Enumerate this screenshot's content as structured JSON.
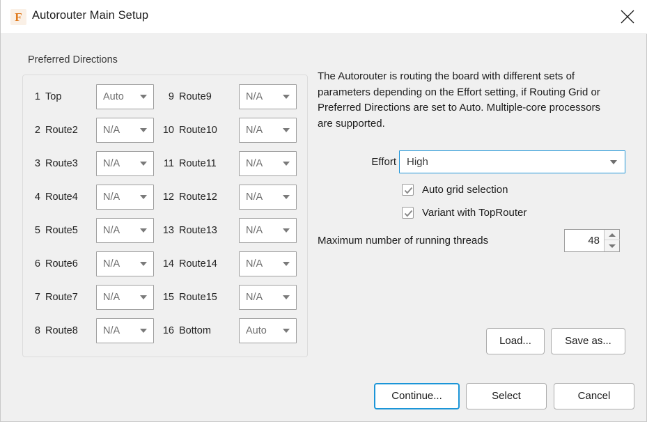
{
  "window": {
    "title": "Autorouter Main Setup",
    "app_icon": "app-icon",
    "app_icon_glyph": "F",
    "close_icon": "close-icon",
    "accent_color": "#1b95d8",
    "background_color": "#f0f0f0",
    "titlebar_color": "#ffffff"
  },
  "preferred_directions": {
    "group_title": "Preferred Directions",
    "rows": [
      {
        "num": "1",
        "label": "Top",
        "value": "Auto"
      },
      {
        "num": "2",
        "label": "Route2",
        "value": "N/A"
      },
      {
        "num": "3",
        "label": "Route3",
        "value": "N/A"
      },
      {
        "num": "4",
        "label": "Route4",
        "value": "N/A"
      },
      {
        "num": "5",
        "label": "Route5",
        "value": "N/A"
      },
      {
        "num": "6",
        "label": "Route6",
        "value": "N/A"
      },
      {
        "num": "7",
        "label": "Route7",
        "value": "N/A"
      },
      {
        "num": "8",
        "label": "Route8",
        "value": "N/A"
      },
      {
        "num": "9",
        "label": "Route9",
        "value": "N/A"
      },
      {
        "num": "10",
        "label": "Route10",
        "value": "N/A"
      },
      {
        "num": "11",
        "label": "Route11",
        "value": "N/A"
      },
      {
        "num": "12",
        "label": "Route12",
        "value": "N/A"
      },
      {
        "num": "13",
        "label": "Route13",
        "value": "N/A"
      },
      {
        "num": "14",
        "label": "Route14",
        "value": "N/A"
      },
      {
        "num": "15",
        "label": "Route15",
        "value": "N/A"
      },
      {
        "num": "16",
        "label": "Bottom",
        "value": "Auto"
      }
    ]
  },
  "settings": {
    "description": "The Autorouter is routing the board with different sets of parameters depending on the Effort setting, if Routing Grid or Preferred Directions are set to Auto. Multiple-core processors are supported.",
    "effort_label": "Effort",
    "effort_value": "High",
    "checkboxes": [
      {
        "label": "Auto grid selection",
        "checked": "true"
      },
      {
        "label": "Variant with TopRouter",
        "checked": "true"
      }
    ],
    "threads_label": "Maximum number of running threads",
    "threads_value": "48"
  },
  "buttons": {
    "load": "Load...",
    "save_as": "Save as...",
    "continue": "Continue...",
    "select": "Select",
    "cancel": "Cancel"
  }
}
